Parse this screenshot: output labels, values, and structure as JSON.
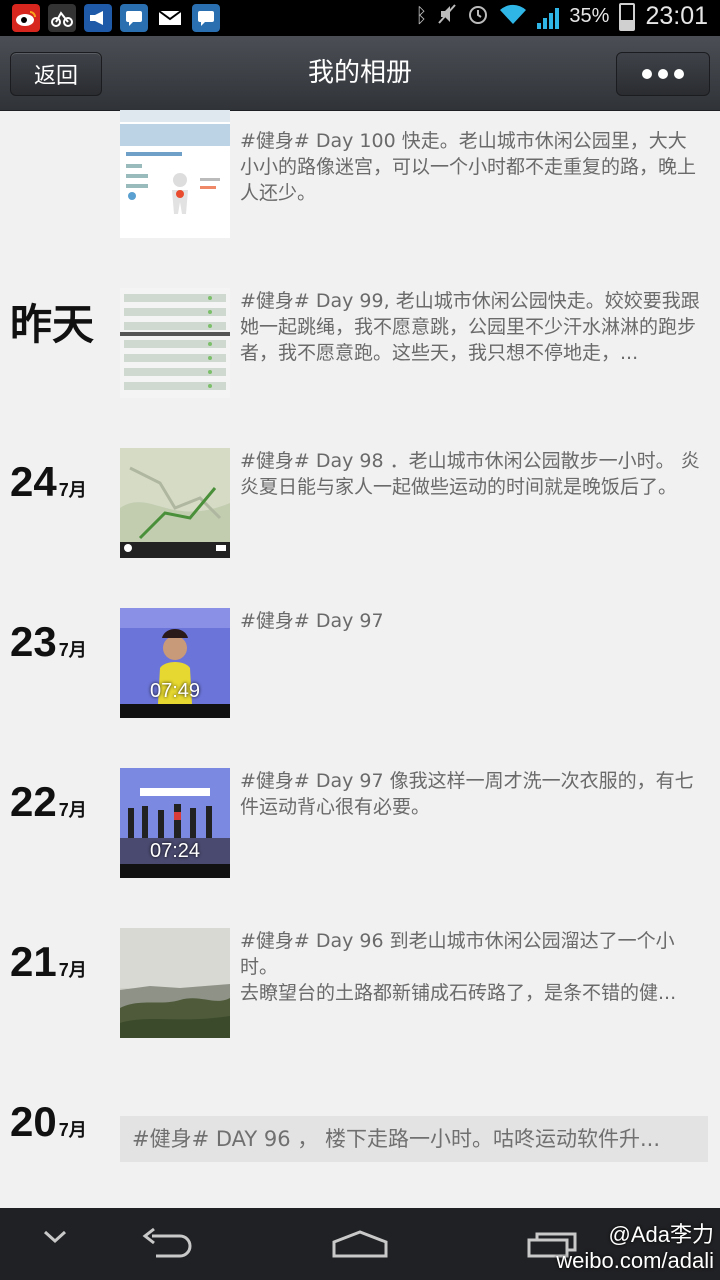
{
  "status_bar": {
    "battery": "35%",
    "battery_level": 0.35,
    "time": "23:01",
    "notification_icons": [
      "weibo-icon",
      "bike-app-icon",
      "megaphone-icon",
      "chat-icon",
      "gmail-icon",
      "chat-icon-2"
    ],
    "system_icons": [
      "bluetooth-icon",
      "mute-icon",
      "alarm-icon",
      "wifi-icon",
      "signal-icon"
    ]
  },
  "header": {
    "back_label": "返回",
    "title": "我的相册",
    "more_icon": "more-dots-icon"
  },
  "entries": [
    {
      "day": "",
      "month": "",
      "text": "#健身# Day 100  快走。老山城市休闲公园里，大大小小的路像迷宫，可以一个小时都不走重复的路，晚上人还少。",
      "thumb": "fitness-app-walk-screenshot"
    },
    {
      "day": "昨天",
      "month": "",
      "text": "#健身# Day 99,  老山城市休闲公园快走。姣姣要我跟她一起跳绳，我不愿意跳，公园里不少汗水淋淋的跑步者，我不愿意跑。这些天，我只想不停地走，...",
      "thumb": "fitness-app-log-list"
    },
    {
      "day": "24",
      "month": "7月",
      "text": "#健身# Day 98 ．老山城市休闲公园散步一小时。 炎炎夏日能与家人一起做些运动的时间就是晚饭后了。",
      "thumb": "map-route-screenshot"
    },
    {
      "day": "23",
      "month": "7月",
      "text": "#健身# Day 97",
      "thumb": "tv-workout-photo",
      "thumb_time": "07:49"
    },
    {
      "day": "22",
      "month": "7月",
      "text": "#健身# Day 97  像我这样一周才洗一次衣服的，有七件运动背心很有必要。",
      "thumb": "tv-aerobics-photo",
      "thumb_time": "07:24"
    },
    {
      "day": "21",
      "month": "7月",
      "text": "#健身# Day 96   到老山城市休闲公园溜达了一个小时。\n去瞭望台的土路都新铺成石砖路了，是条不错的健...",
      "thumb": "park-view-photo"
    },
    {
      "day": "20",
      "month": "7月",
      "text": "#健身# DAY 96 ， 楼下走路一小时。咕咚运动软件升..."
    }
  ],
  "nav_bar": {
    "icons": [
      "chevron-down-icon",
      "back-arrow-icon",
      "home-icon",
      "recent-apps-icon"
    ]
  },
  "watermark": {
    "handle": "@Ada李力",
    "url": "weibo.com/adali"
  }
}
